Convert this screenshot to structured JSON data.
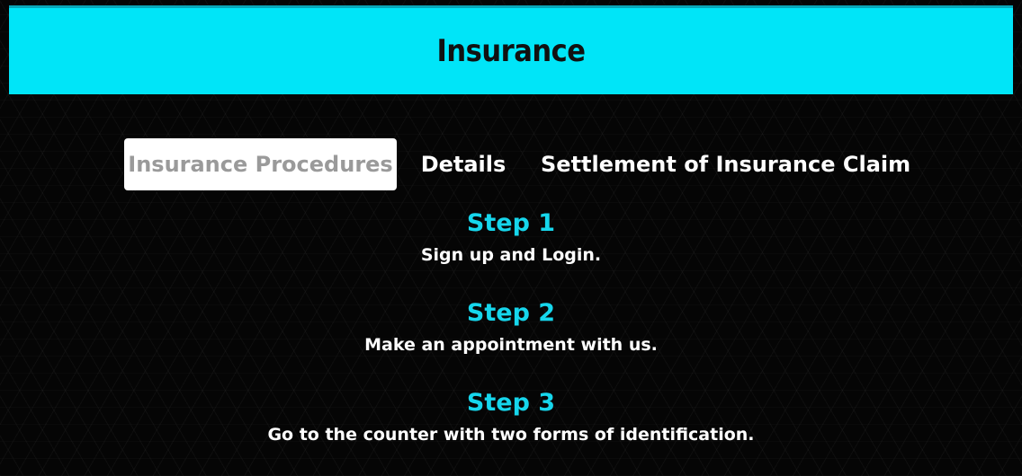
{
  "header": {
    "title": "Insurance",
    "background_color": "#00e5f8"
  },
  "tabs": [
    {
      "label": "Insurance Procedures",
      "active": true
    },
    {
      "label": "Details",
      "active": false
    },
    {
      "label": "Settlement of Insurance Claim",
      "active": false
    }
  ],
  "steps": [
    {
      "title": "Step 1",
      "text": "Sign up and Login."
    },
    {
      "title": "Step 2",
      "text": "Make an appointment with us."
    },
    {
      "title": "Step 3",
      "text": "Go to the counter with two forms of identification."
    }
  ],
  "colors": {
    "accent": "#16d6ec",
    "background": "#050505",
    "text": "#ffffff",
    "active_tab_text": "#9a9a9a"
  }
}
